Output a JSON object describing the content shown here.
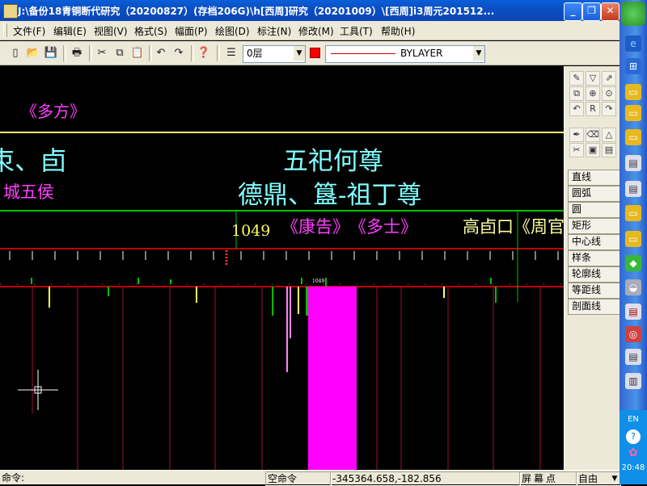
{
  "window": {
    "title": "J:\\备份18青铜断代研究（20200827）(存档206G)\\h[西周]研究（20201009）\\[西周]i3周元201512..."
  },
  "menus": [
    {
      "label": "文件(F)"
    },
    {
      "label": "编辑(E)"
    },
    {
      "label": "视图(V)"
    },
    {
      "label": "格式(S)"
    },
    {
      "label": "幅面(P)"
    },
    {
      "label": "绘图(D)"
    },
    {
      "label": "标注(N)"
    },
    {
      "label": "修改(M)"
    },
    {
      "label": "工具(T)"
    },
    {
      "label": "帮助(H)"
    }
  ],
  "toolbar": {
    "layer": "0层",
    "linetype": "BYLAYER",
    "color": "#ff0000"
  },
  "drawing": {
    "labels": {
      "duofang_top": "《多方》",
      "left_frag1": "朿、卣",
      "left_frag2": "城五侯",
      "center1": "五祀何尊",
      "center2": "德鼎、簋-祖丁尊",
      "number1049": "1049",
      "kanggao": "《康告》",
      "duoshi": "《多士》",
      "right_frag": "高卣口《周官",
      "small_mark": "1049"
    },
    "colors": {
      "magenta": "#ff00ff",
      "cyan": "#80ffff",
      "yellow": "#ffff00",
      "red": "#ff0000",
      "green": "#00c000",
      "purple": "#ff40ff"
    }
  },
  "palette": {
    "icons": [
      "pencil-icon",
      "arrow-icon",
      "select-icon",
      "copy-icon",
      "zoom-icon",
      "zoom-window-icon",
      "undo-icon",
      "r-icon",
      "redo-icon",
      "pen-icon",
      "eraser-icon",
      "triangle-icon",
      "cut-icon",
      "cube-icon",
      "block-icon"
    ],
    "commands": [
      "直线",
      "圆弧",
      "圆",
      "矩形",
      "中心线",
      "样条",
      "轮廓线",
      "等距线",
      "剖面线"
    ]
  },
  "statusbar": {
    "prompt": "命令:",
    "current_command": "空命令",
    "coordinates": "-345364.658,-182.856",
    "screen_point": "屏幕点",
    "snap_mode": "自由"
  },
  "taskbar": {
    "lang": "EN",
    "time": "20:48"
  }
}
